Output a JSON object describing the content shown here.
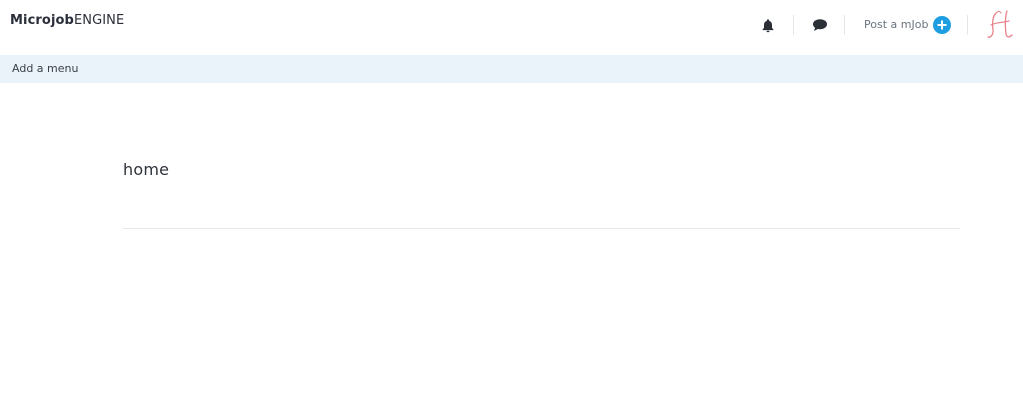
{
  "header": {
    "logo_bold": "Microjob",
    "logo_light": "ENGINE",
    "notifications_icon": "bell-icon",
    "messages_icon": "chat-bubble-icon",
    "post_link": "Post a mJob",
    "post_icon": "plus-circle-icon",
    "avatar_icon": "avatar-script-h-icon"
  },
  "menubar": {
    "add_menu": "Add a menu"
  },
  "main": {
    "title": "home"
  },
  "colors": {
    "accent": "#1e9ee0",
    "menubar_bg": "#eaf3f9",
    "avatar": "#e8838b"
  }
}
